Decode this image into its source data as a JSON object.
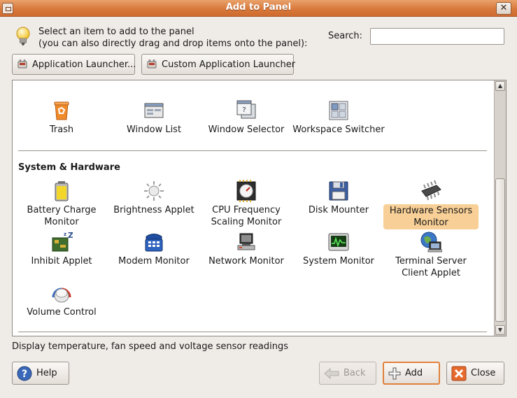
{
  "window": {
    "title": "Add to Panel",
    "close_glyph": "✕"
  },
  "header": {
    "instruction_line1": "Select an item to add to the panel",
    "instruction_line2": "(you can also directly drag and drop items onto the panel):",
    "search_label": "Search:",
    "search_value": "",
    "search_placeholder": ""
  },
  "launchers": {
    "app_launcher_label": "Application Launcher...",
    "custom_launcher_label": "Custom Application Launcher"
  },
  "top_items": [
    {
      "label": "Trash",
      "icon": "trash-icon"
    },
    {
      "label": "Window List",
      "icon": "window-list-icon"
    },
    {
      "label": "Window Selector",
      "icon": "window-selector-icon"
    },
    {
      "label": "Workspace Switcher",
      "icon": "workspace-switcher-icon"
    }
  ],
  "section": {
    "title": "System & Hardware",
    "items": [
      {
        "label": "Battery Charge Monitor",
        "icon": "battery-icon"
      },
      {
        "label": "Brightness Applet",
        "icon": "brightness-icon"
      },
      {
        "label": "CPU Frequency Scaling Monitor",
        "icon": "cpu-frequency-icon"
      },
      {
        "label": "Disk Mounter",
        "icon": "disk-mounter-icon"
      },
      {
        "label": "Hardware Sensors Monitor",
        "icon": "hardware-sensors-icon",
        "selected": true
      },
      {
        "label": "Inhibit Applet",
        "icon": "inhibit-icon"
      },
      {
        "label": "Modem Monitor",
        "icon": "modem-icon"
      },
      {
        "label": "Network Monitor",
        "icon": "network-monitor-icon"
      },
      {
        "label": "System Monitor",
        "icon": "system-monitor-icon"
      },
      {
        "label": "Terminal Server Client Applet",
        "icon": "terminal-server-icon"
      },
      {
        "label": "Volume Control",
        "icon": "volume-control-icon"
      }
    ]
  },
  "status_text": "Display temperature, fan speed and voltage sensor readings",
  "buttons": {
    "help": "Help",
    "back": "Back",
    "add": "Add",
    "close": "Close"
  },
  "colors": {
    "titlebar": "#d9793c",
    "selection": "#f8cf96",
    "focus": "#e0813c"
  }
}
